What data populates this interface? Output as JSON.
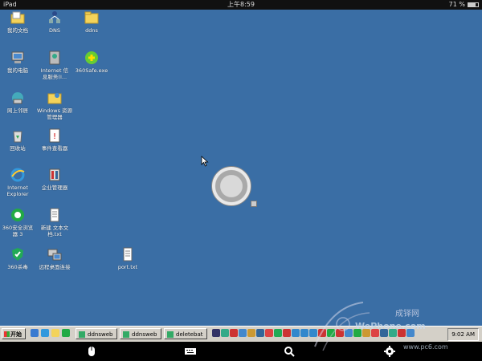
{
  "status_bar": {
    "device": "iPad",
    "time": "上午8:59",
    "battery": "71 %",
    "battery_level": 0.71
  },
  "desktop": {
    "icons": [
      {
        "id": "my-documents",
        "label": "我的文档",
        "icon": "folder-doc-icon"
      },
      {
        "id": "dns",
        "label": "DNS",
        "icon": "network-icon"
      },
      {
        "id": "ddns",
        "label": "ddns",
        "icon": "folder-icon"
      },
      {
        "id": "my-computer",
        "label": "我的电脑",
        "icon": "computer-icon"
      },
      {
        "id": "internet-info",
        "label": "Internet 信\n息服务(I...",
        "icon": "iis-icon"
      },
      {
        "id": "360safe-exe",
        "label": "360Safe.exe",
        "icon": "360safe-icon"
      },
      {
        "id": "network-places",
        "label": "网上邻居",
        "icon": "network-places-icon"
      },
      {
        "id": "windows-explorer",
        "label": "Windows 资源\n管理器",
        "icon": "explorer-icon"
      },
      {
        "id": "recycle-bin",
        "label": "回收站",
        "icon": "recycle-bin-icon"
      },
      {
        "id": "event-viewer",
        "label": "事件查看器",
        "icon": "event-viewer-icon"
      },
      {
        "id": "internet-explorer",
        "label": "Internet\nExplorer",
        "icon": "ie-icon"
      },
      {
        "id": "enterprise-manager",
        "label": "企业管理器",
        "icon": "enterprise-manager-icon"
      },
      {
        "id": "360-browser",
        "label": "360安全浏览\n器 3",
        "icon": "360-browser-icon"
      },
      {
        "id": "new-text",
        "label": "新建 文本文\n档.txt",
        "icon": "text-file-icon"
      },
      {
        "id": "360-antivirus",
        "label": "360杀毒",
        "icon": "360-antivirus-icon"
      },
      {
        "id": "remote-desktop",
        "label": "远程桌面连接",
        "icon": "remote-desktop-icon"
      },
      {
        "id": "port-txt",
        "label": "port.txt",
        "icon": "text-file-icon"
      }
    ]
  },
  "taskbar": {
    "start_label": "开始",
    "tasks": [
      "ddnsweb",
      "ddnsweb",
      "deletebat"
    ],
    "clock": "9:02 AM"
  },
  "watermark": {
    "site": "成铎网",
    "brand": "WePhone.com",
    "url": "www.pc6.com"
  },
  "colors": {
    "desktop": "#3a6ea5",
    "taskbar": "#d4d0c8"
  }
}
